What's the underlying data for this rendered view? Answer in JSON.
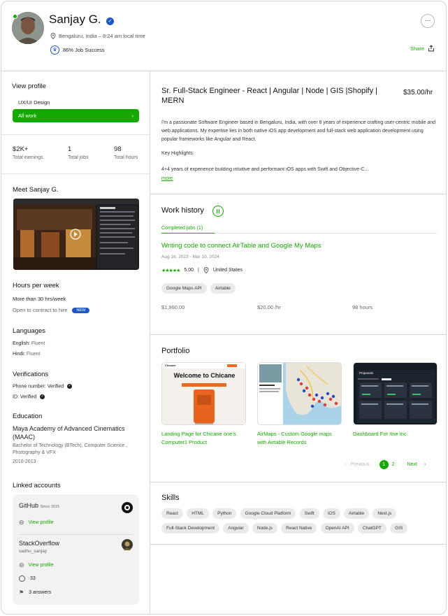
{
  "profile": {
    "name": "Sanjay G.",
    "location": "Bengaluru, India – 8:24 am local time",
    "job_success": "86% Job Success",
    "share_label": "Share"
  },
  "sidebar": {
    "view_profile_title": "View profile",
    "specialization": "UX/UI Design",
    "all_work_label": "All work",
    "stats": [
      {
        "value": "$2K+",
        "label": "Total earnings"
      },
      {
        "value": "1",
        "label": "Total jobs"
      },
      {
        "value": "98",
        "label": "Total hours"
      }
    ],
    "meet_title": "Meet Sanjay G.",
    "hours_title": "Hours per week",
    "hours_value": "More than 30 hrs/week",
    "open_to_contract": "Open to contract to hire",
    "new_badge": "NEW",
    "languages_title": "Languages",
    "languages": [
      {
        "name": "English:",
        "level": "Fluent"
      },
      {
        "name": "Hindi:",
        "level": "Fluent"
      }
    ],
    "verifications_title": "Verifications",
    "verifications": [
      {
        "label": "Phone number:",
        "value": "Verified"
      },
      {
        "label": "ID:",
        "value": "Verified"
      }
    ],
    "education_title": "Education",
    "education": {
      "school": "Maya Academy of Advanced Cinematics (MAAC)",
      "degree": "Bachelor of Technology (BTech), Computer Science , Photography & VFX",
      "years": "2010-2013"
    },
    "linked_title": "Linked accounts",
    "github": {
      "name": "GitHub",
      "since": "Since 2015",
      "view": "View profile"
    },
    "stackoverflow": {
      "name": "StackOverflow",
      "user": "sadhu_sanjay",
      "view": "View profile",
      "reputation": "33",
      "answers": "3 answers"
    }
  },
  "main": {
    "title": "Sr. Full-Stack Engineer - React | Angular | Node | GIS |Shopify | MERN",
    "rate": "$35.00/hr",
    "overview_p1": "I'm a passionate Software Engineer based in Bengaluru, India, with over 8 years of experience crafting user-centric mobile and web applications. My expertise lies in both native iOS app development and full-stack web application development using popular frameworks like Angular and React.",
    "highlights_title": "Key Highlights:",
    "highlight_1": "4+4 years of experience building intuitive and performant iOS apps with Swift and Objective-C...",
    "more_label": "more",
    "work_history_title": "Work history",
    "completed_tab": "Completed jobs (1)",
    "job": {
      "title": "Writing code to connect AirTable and Google My Maps",
      "dates": "Aug 16, 2023 - Mar 10, 2024",
      "stars": "★★★★★",
      "rating": "5.00",
      "country": "United States",
      "tags": [
        "Google Maps API",
        "Airtable"
      ],
      "earned": "$1,960.00",
      "rate": "$20.00 /hr",
      "hours": "98 hours"
    },
    "portfolio_title": "Portfolio",
    "portfolio": [
      {
        "title": "Landing Page for Chicane one's Computer1 Product",
        "thumb_heading": "Welcome to Chicane",
        "thumb_brand": "Chicane"
      },
      {
        "title": "AirMaps - Custom Google maps with Airtable Records"
      },
      {
        "title": "Dashboard For Itne Inc",
        "thumb_heading": "Proposals"
      }
    ],
    "pagination": {
      "prev": "Previous",
      "pages": [
        "1",
        "2"
      ],
      "next": "Next"
    },
    "skills_title": "Skills",
    "skills": [
      "React",
      "HTML",
      "Python",
      "Google Cloud Platform",
      "Swift",
      "iOS",
      "Airtable",
      "Next.js",
      "Full-Stack Development",
      "Angular",
      "Node.js",
      "React Native",
      "OpenAI API",
      "ChatGPT",
      "GIS"
    ]
  },
  "colors": {
    "accent": "#14a800",
    "blue": "#1f57c3",
    "border": "#d5d5d5"
  }
}
